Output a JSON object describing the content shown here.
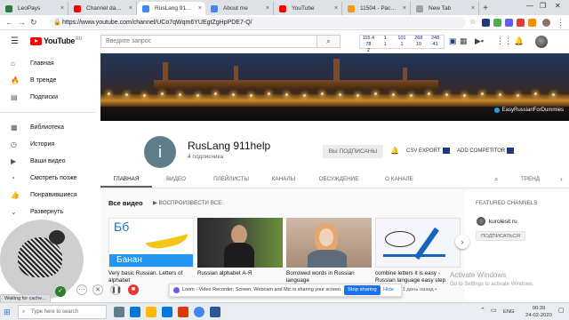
{
  "browser": {
    "tabs": [
      {
        "label": "LeoPays",
        "color": "#2e7d32"
      },
      {
        "label": "Channel dashboard",
        "color": "#ff0000"
      },
      {
        "label": "RusLang 911help",
        "color": "#4285f4"
      },
      {
        "label": "About me",
        "color": "#4285f4"
      },
      {
        "label": "YouTube",
        "color": "#ff0000"
      },
      {
        "label": "11504 - Рассылк",
        "color": "#f39c12"
      },
      {
        "label": "New Tab",
        "color": "#9e9e9e"
      }
    ],
    "active_tab_index": 2,
    "new_tab": "+",
    "url": "https://www.youtube.com/channel/UCo7qWqm6YUEgtZgHpPDE7-Q/"
  },
  "yt": {
    "logo": "YouTube",
    "region": "RU",
    "search_placeholder": "Введите запрос",
    "stats": [
      "115.4",
      "1",
      "101",
      "268",
      "248",
      "78",
      "1",
      "1",
      "10",
      "41",
      "2"
    ]
  },
  "sidebar": {
    "items": [
      {
        "label": "Главная",
        "icon": "home-icon",
        "glyph": "⌂"
      },
      {
        "label": "В тренде",
        "icon": "trending-icon",
        "glyph": "🔥"
      },
      {
        "label": "Подписки",
        "icon": "subscriptions-icon",
        "glyph": "▤"
      }
    ],
    "library": [
      {
        "label": "Библиотека",
        "icon": "library-icon",
        "glyph": "▦"
      },
      {
        "label": "История",
        "icon": "history-icon",
        "glyph": "◷"
      },
      {
        "label": "Ваши видео",
        "icon": "your-videos-icon",
        "glyph": "▶"
      },
      {
        "label": "Смотреть позже",
        "icon": "watch-later-icon",
        "glyph": "◔"
      },
      {
        "label": "Понравившиеся",
        "icon": "liked-icon",
        "glyph": "👍"
      },
      {
        "label": "Развернуть",
        "icon": "chevron-down-icon",
        "glyph": "⌄"
      }
    ]
  },
  "banner": {
    "handle": "EasyRussianForDummies"
  },
  "channel": {
    "avatar_letter": "i",
    "avatar_color": "#607d8b",
    "name": "RusLang 911help",
    "subscribers": "4 подписчика",
    "subscribed_label": "ВЫ ПОДПИСАНЫ",
    "csv_export": "CSV EXPORT",
    "add_competitor": "ADD COMPETITOR"
  },
  "channel_tabs": [
    "ГЛАВНАЯ",
    "ВИДЕО",
    "ПЛЕЙЛИСТЫ",
    "КАНАЛЫ",
    "ОБСУЖДЕНИЕ",
    "О КАНАЛЕ"
  ],
  "channel_tabs_overflow": "ТРЕНД",
  "section": {
    "title": "Все видео",
    "play_all": "ВОСПРОИЗВЕСТИ ВСЕ"
  },
  "videos": [
    {
      "title": "Very basic Russian. Letters of alphabet",
      "thumb_text_top": "Бб",
      "thumb_text_bottom": "Банан"
    },
    {
      "title": "Russian alphabet А-Я",
      "thumb_text_top": "",
      "thumb_text_bottom": ""
    },
    {
      "title": "Borrowed words in Russian language",
      "thumb_text_top": "",
      "thumb_text_bottom": ""
    },
    {
      "title": "combine letters it is easy - Russian language easy step",
      "thumb_text_top": "",
      "thumb_text_bottom": ""
    }
  ],
  "video4_meta": "просмотр • 1 день назад •",
  "featured": {
    "title": "FEATURED CHANNELS",
    "channel_name": "kurolesit ru",
    "subscribe": "ПОДПИСАТЬСЯ"
  },
  "watermark": {
    "line1": "Activate Windows",
    "line2": "Go to Settings to activate Windows."
  },
  "loom": {
    "text": "Loom - Video Recorder: Screen, Webcam and Mic is sharing your screen.",
    "stop": "Stop sharing",
    "hide": "Hide"
  },
  "status": "Waiting for cache...",
  "taskbar": {
    "search_placeholder": "Type here to search",
    "lang": "ENG",
    "time": "00:39",
    "date": "24-02-2020"
  }
}
